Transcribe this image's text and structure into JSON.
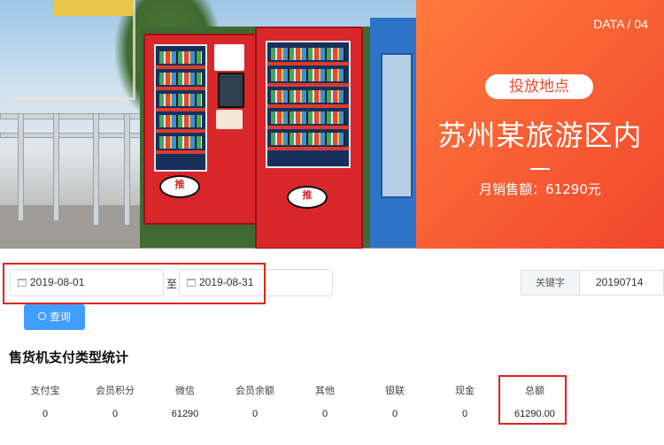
{
  "banner": {
    "tag": "DATA / 04",
    "pill_label": "投放地点",
    "location": "苏州某旅游区内",
    "monthly_sales": "月销售额：61290元",
    "machine_sign": "推"
  },
  "filter": {
    "start_date": "2019-08-01",
    "separator": "至",
    "end_date": "2019-08-31",
    "keyword_label": "关键字",
    "keyword_value": "20190714",
    "query_button": "查询"
  },
  "stats": {
    "title": "售货机支付类型统计",
    "headers": [
      "支付宝",
      "会员积分",
      "微信",
      "会员余额",
      "其他",
      "银联",
      "现金",
      "总额"
    ],
    "values": [
      "0",
      "0",
      "61290",
      "0",
      "0",
      "0",
      "0",
      "61290.00"
    ]
  },
  "colors": {
    "accent": "#f04a2c",
    "primary": "#409eff",
    "highlight": "#e2231a"
  },
  "icons": [
    "calendar-icon",
    "search-icon"
  ]
}
